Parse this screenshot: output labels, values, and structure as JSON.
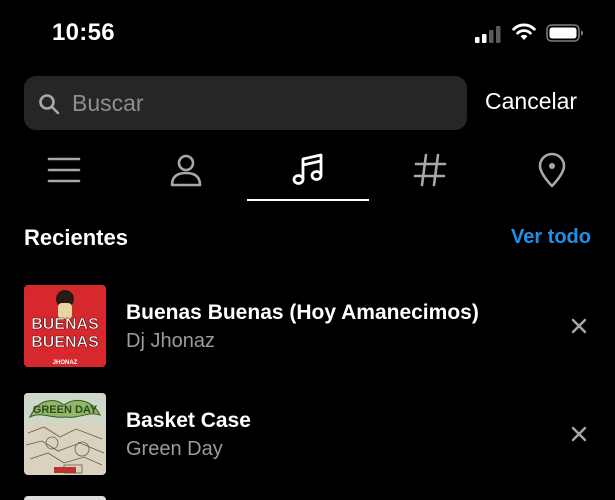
{
  "status_bar": {
    "time": "10:56"
  },
  "search": {
    "placeholder": "Buscar",
    "value": "",
    "cancel_label": "Cancelar"
  },
  "tabs": [
    {
      "name": "top",
      "icon": "menu-icon",
      "selected": false
    },
    {
      "name": "accounts",
      "icon": "person-icon",
      "selected": false
    },
    {
      "name": "audio",
      "icon": "music-note-icon",
      "selected": true
    },
    {
      "name": "tags",
      "icon": "hashtag-icon",
      "selected": false
    },
    {
      "name": "places",
      "icon": "location-pin-icon",
      "selected": false
    }
  ],
  "recent": {
    "title": "Recientes",
    "see_all_label": "Ver todo",
    "items": [
      {
        "title": "Buenas Buenas (Hoy Amanecimos)",
        "artist": "Dj Jhonaz",
        "cover_text": "BUENAS BUENAS",
        "cover_subtext": "JHONAZ"
      },
      {
        "title": "Basket Case",
        "artist": "Green Day",
        "cover_text": "GREEN DAY"
      }
    ]
  },
  "colors": {
    "background": "#000000",
    "search_field": "#262626",
    "link_blue": "#1f8fe8",
    "secondary_text": "#9b9b9b",
    "icon_gray": "#a8a8a8"
  }
}
